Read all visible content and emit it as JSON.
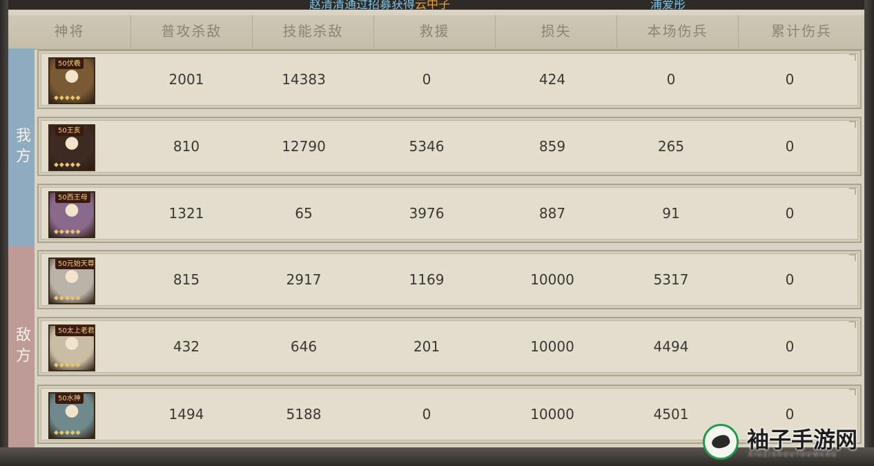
{
  "banner": {
    "left_pre": "赵清清通过招募获得",
    "left_highlight": "云中子",
    "right": "浦爱彤"
  },
  "columns": [
    "神将",
    "普攻杀敌",
    "技能杀敌",
    "救援",
    "损失",
    "本场伤兵",
    "累计伤兵"
  ],
  "sides": {
    "ally": "我方",
    "enemy": "敌方"
  },
  "rows": [
    {
      "level_name": "50伏羲",
      "portrait_color": "#7a5a34",
      "values": [
        "2001",
        "14383",
        "0",
        "424",
        "0",
        "0"
      ]
    },
    {
      "level_name": "50王亥",
      "portrait_color": "#3d2a22",
      "values": [
        "810",
        "12790",
        "5346",
        "859",
        "265",
        "0"
      ]
    },
    {
      "level_name": "50西王母",
      "portrait_color": "#8a6a8c",
      "values": [
        "1321",
        "65",
        "3976",
        "887",
        "91",
        "0"
      ]
    },
    {
      "level_name": "50元始天尊",
      "portrait_color": "#b9b3a8",
      "values": [
        "815",
        "2917",
        "1169",
        "10000",
        "5317",
        "0"
      ]
    },
    {
      "level_name": "50太上老君",
      "portrait_color": "#c9bda4",
      "values": [
        "432",
        "646",
        "201",
        "10000",
        "4494",
        "0"
      ]
    },
    {
      "level_name": "50水神",
      "portrait_color": "#6e8a8c",
      "values": [
        "1494",
        "5188",
        "0",
        "10000",
        "4501",
        "0"
      ]
    }
  ],
  "watermark": {
    "title": "袖子手游网",
    "subtitle": "XIUZISHOUYOUWANG"
  }
}
